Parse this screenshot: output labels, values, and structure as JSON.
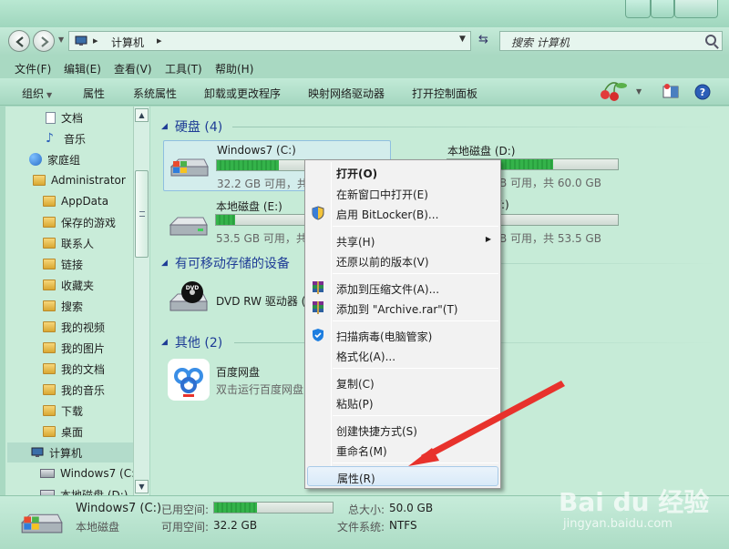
{
  "window": {
    "title_faded": ""
  },
  "address": {
    "crumb": "计算机",
    "search_placeholder": "搜索 计算机"
  },
  "menubar": [
    "文件(F)",
    "编辑(E)",
    "查看(V)",
    "工具(T)",
    "帮助(H)"
  ],
  "toolbar": {
    "organize": "组织",
    "properties": "属性",
    "system_properties": "系统属性",
    "uninstall": "卸载或更改程序",
    "map_drive": "映射网络驱动器",
    "control_panel": "打开控制面板"
  },
  "sidebar": [
    "文档",
    "音乐",
    "家庭组",
    "Administrator",
    "AppData",
    "保存的游戏",
    "联系人",
    "链接",
    "收藏夹",
    "搜索",
    "我的视频",
    "我的图片",
    "我的文档",
    "我的音乐",
    "下载",
    "桌面",
    "计算机",
    "Windows7 (C:",
    "本地磁盘 (D:)"
  ],
  "groups": {
    "hdd": "硬盘 (4)",
    "removable": "有可移动存储的设备",
    "other": "其他 (2)"
  },
  "drives": [
    {
      "name": "Windows7 (C:)",
      "sub": "32.2 GB 可用，共",
      "used_fraction": 0.36
    },
    {
      "name": "本地磁盘 (D:)",
      "sub": "B 可用，共 60.0 GB",
      "used_fraction": 0.62
    },
    {
      "name": "本地磁盘 (E:)",
      "sub": "53.5 GB 可用，共",
      "used_fraction": 0.11
    },
    {
      "name": "F:)",
      "sub": "B 可用，共 53.5 GB",
      "used_fraction": 0.0
    }
  ],
  "dvd": {
    "name": "DVD RW 驱动器 (",
    "badge": "DVD"
  },
  "baidu": {
    "name": "百度网盘",
    "sub": "双击运行百度网盘"
  },
  "context_menu": {
    "open": "打开(O)",
    "open_new_window": "在新窗口中打开(E)",
    "bitlocker": "启用 BitLocker(B)...",
    "share": "共享(H)",
    "restore": "还原以前的版本(V)",
    "add_archive": "添加到压缩文件(A)...",
    "add_rar": "添加到 \"Archive.rar\"(T)",
    "scan": "扫描病毒(电脑管家)",
    "format": "格式化(A)...",
    "copy": "复制(C)",
    "paste": "粘贴(P)",
    "shortcut": "创建快捷方式(S)",
    "rename": "重命名(M)",
    "properties": "属性(R)"
  },
  "status": {
    "name": "Windows7 (C:)",
    "type": "本地磁盘",
    "used_label": "已用空间:",
    "free_label": "可用空间:",
    "free_value": "32.2 GB",
    "total_label": "总大小:",
    "total_value": "50.0 GB",
    "fs_label": "文件系统:",
    "fs_value": "NTFS",
    "used_fraction": 0.36
  },
  "watermark": {
    "logo": "Bai du 经验",
    "url": "jingyan.baidu.com"
  },
  "colors": {
    "accent_green": "#2aa03f",
    "group_blue": "#1e3c96",
    "annotation_red": "#e8322c"
  }
}
